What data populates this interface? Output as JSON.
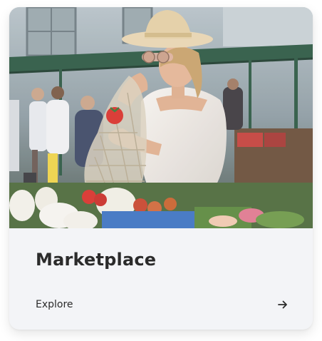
{
  "card": {
    "title": "Marketplace",
    "link_label": "Explore",
    "link_icon": "arrow-right-icon",
    "image_subject": "woman-at-market-photo"
  },
  "colors": {
    "card_background": "#f3f4f7",
    "text": "#2b2b2b",
    "market_green": "#2e5a45"
  }
}
